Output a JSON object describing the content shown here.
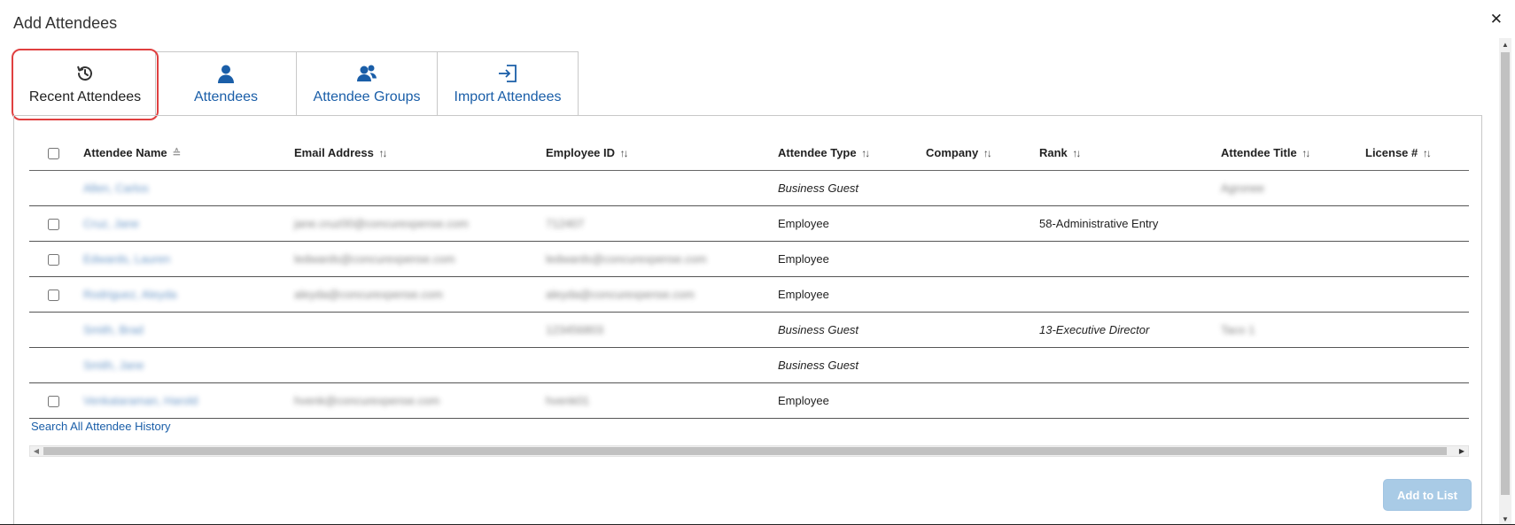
{
  "dialog": {
    "title": "Add Attendees",
    "close_icon": "✕"
  },
  "tabs": [
    {
      "label": "Recent Attendees",
      "icon": "history-icon"
    },
    {
      "label": "Attendees",
      "icon": "user-icon"
    },
    {
      "label": "Attendee Groups",
      "icon": "users-icon"
    },
    {
      "label": "Import Attendees",
      "icon": "import-icon"
    }
  ],
  "grid": {
    "columns": {
      "name": "Attendee Name",
      "email": "Email Address",
      "employee_id": "Employee ID",
      "type": "Attendee Type",
      "company": "Company",
      "rank": "Rank",
      "title": "Attendee Title",
      "license": "License #"
    },
    "sort_icons": {
      "asc": "≙",
      "both": "↑↓"
    },
    "rows": [
      {
        "name": "Allen, Carlos",
        "email": "",
        "employee_id": "",
        "type": "Business Guest",
        "company": "",
        "rank": "",
        "title": "Agronee",
        "license": ""
      },
      {
        "name": "Cruz, Jane",
        "email": "jane.cruz00@concurexpense.com",
        "employee_id": "712407",
        "type": "Employee",
        "company": "",
        "rank": "58-Administrative Entry",
        "title": "",
        "license": ""
      },
      {
        "name": "Edwards, Lauren",
        "email": "ledwards@concurexpense.com",
        "employee_id": "ledwards@concurexpense.com",
        "type": "Employee",
        "company": "",
        "rank": "",
        "title": "",
        "license": ""
      },
      {
        "name": "Rodriguez, Aleyda",
        "email": "aleyda@concurexpense.com",
        "employee_id": "aleyda@concurexpense.com",
        "type": "Employee",
        "company": "",
        "rank": "",
        "title": "",
        "license": ""
      },
      {
        "name": "Smith, Brad",
        "email": "",
        "employee_id": "123456803",
        "type": "Business Guest",
        "company": "",
        "rank": "13-Executive Director",
        "title": "Taco 1",
        "license": ""
      },
      {
        "name": "Smith, Jane",
        "email": "",
        "employee_id": "",
        "type": "Business Guest",
        "company": "",
        "rank": "",
        "title": "",
        "license": ""
      },
      {
        "name": "Venkataraman, Harold",
        "email": "hvenk@concurexpense.com",
        "employee_id": "hvenk01",
        "type": "Employee",
        "company": "",
        "rank": "",
        "title": "",
        "license": ""
      }
    ]
  },
  "links": {
    "search_history": "Search All Attendee History"
  },
  "buttons": {
    "add_to_list": "Add to List"
  },
  "colors": {
    "link": "#1a5ea8",
    "highlight": "#e04040",
    "button_disabled": "#a9cbe6"
  }
}
